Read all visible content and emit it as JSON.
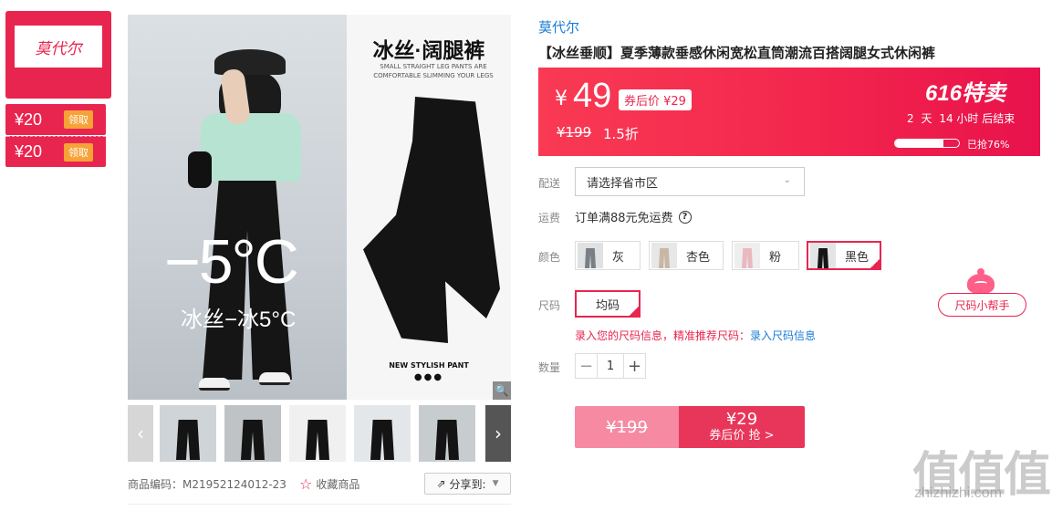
{
  "shop": {
    "logo_text": "莫代尔",
    "coupons": [
      {
        "amount": "¥20",
        "action": "领取"
      },
      {
        "amount": "¥20",
        "action": "领取"
      }
    ]
  },
  "gallery": {
    "main_left_big": "−5°C",
    "main_left_sub": "冰丝−冰5°C",
    "main_right_title": "冰丝·阔腿裤",
    "main_right_desc": "SMALL STRAIGHT LEG PANTS ARE COMFORTABLE SLIMMING YOUR LEGS",
    "main_right_footer": "NEW STYLISH PANT",
    "main_right_dots": "●●●",
    "zoom_icon": "🔍",
    "prev_arrow": "‹",
    "next_arrow": "›",
    "thumbnails": [
      {
        "bg": "#cfd4d8"
      },
      {
        "bg": "#bfc3c6"
      },
      {
        "bg": "#f0f0f0"
      },
      {
        "bg": "#e4e7ea"
      },
      {
        "bg": "#c7cccf"
      }
    ]
  },
  "meta": {
    "code": "商品编码：M21952124012-23",
    "fav_icon": "☆",
    "fav_label": "收藏商品",
    "share_icon": "⇗",
    "share_label": "分享到:",
    "share_caret": "▼"
  },
  "product": {
    "brand": "莫代尔",
    "title": "【冰丝垂顺】夏季薄款垂感休闲宽松直筒潮流百搭阔腿女式休闲裤"
  },
  "price": {
    "currency": "¥",
    "now": "49",
    "after_coupon": "券后价 ¥29",
    "original": "¥199",
    "discount": "1.5折",
    "event": "616特卖",
    "countdown_days": "2",
    "countdown_day_unit": "天",
    "countdown_hours": "14",
    "countdown_suffix": "小时 后结束",
    "sold_pct": 76,
    "sold_label": "已抢76%"
  },
  "delivery": {
    "label": "配送",
    "placeholder": "请选择省市区",
    "chev": "⌄"
  },
  "shipping": {
    "label": "运费",
    "text": "订单满88元免运费",
    "help": "?"
  },
  "colors": {
    "label": "颜色",
    "options": [
      {
        "name": "灰",
        "swatch": "#7a7f85",
        "selected": false
      },
      {
        "name": "杏色",
        "swatch": "#c8b7a6",
        "selected": false
      },
      {
        "name": "粉",
        "swatch": "#e9b9bf",
        "selected": false
      },
      {
        "name": "黑色",
        "swatch": "#151515",
        "selected": true
      }
    ]
  },
  "size": {
    "label": "尺码",
    "option": "均码",
    "helper": "尺码小帮手",
    "hint_a": "录入您的尺码信息，精准推荐尺码：",
    "hint_b": "录入尺码信息"
  },
  "quantity": {
    "label": "数量",
    "minus": "−",
    "value": "1",
    "plus": "+"
  },
  "buy": {
    "old_price": "¥199",
    "new_price": "¥29",
    "new_label": "券后价 抢 >"
  },
  "watermark": {
    "brand": "值值值",
    "url": "zhizhizhi.com"
  },
  "colors_theme": {
    "accent": "#e8254f",
    "link": "#1a7bd6"
  }
}
